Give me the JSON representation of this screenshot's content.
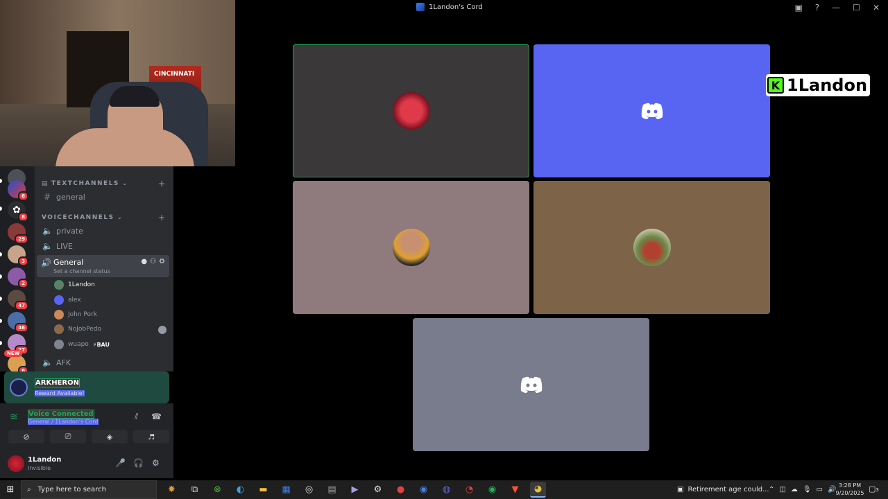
{
  "window": {
    "title": "1Landon's Cord"
  },
  "webcam": {
    "flag_text": "CINCINNATI"
  },
  "servers": {
    "badges": [
      "6",
      "8",
      "29",
      "3",
      "2",
      "47",
      "46",
      "27",
      "6"
    ],
    "new_label": "NEW"
  },
  "channels": {
    "text_category": "TEXTCHANNELS",
    "voice_category": "VOICECHANNELS",
    "text": [
      {
        "name": "general"
      }
    ],
    "voice": [
      {
        "name": "private"
      },
      {
        "name": "LIVE"
      }
    ],
    "active": {
      "name": "General",
      "status": "Set a channel status"
    },
    "afk": "AFK",
    "users": [
      {
        "name": "1Landon",
        "active": true
      },
      {
        "name": "alex",
        "active": false
      },
      {
        "name": "John Pork",
        "active": false
      },
      {
        "name": "NoJobPedo",
        "active": false
      },
      {
        "name": "wuapo",
        "active": false,
        "tag": "BAU"
      }
    ]
  },
  "promo": {
    "title": "ARKHERON",
    "subtitle": "Reward Available!"
  },
  "voice_panel": {
    "status": "Voice Connected",
    "location": "General / 1Landon's Cord"
  },
  "user_panel": {
    "name": "1Landon",
    "status": "Invisible"
  },
  "stream_overlay": {
    "logo_letter": "K",
    "name": "1Landon"
  },
  "taskbar": {
    "search_placeholder": "Type here to search",
    "news": "Retirement age could...",
    "time": "3:28 PM",
    "date": "9/20/2025",
    "notifications": "3"
  },
  "colors": {
    "discord_blurple": "#5865f2",
    "speaking_green": "#23a55a",
    "kick_green": "#53fc18"
  }
}
